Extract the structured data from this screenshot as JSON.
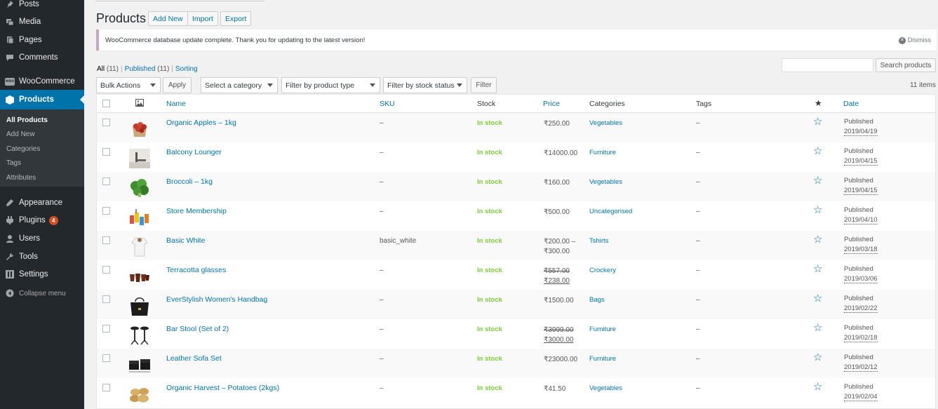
{
  "sidebar": {
    "items": [
      {
        "label": "Posts",
        "icon": "pushpin-icon"
      },
      {
        "label": "Media",
        "icon": "media-icon"
      },
      {
        "label": "Pages",
        "icon": "pages-icon"
      },
      {
        "label": "Comments",
        "icon": "comments-icon"
      },
      {
        "label": "WooCommerce",
        "icon": "woocommerce-icon"
      },
      {
        "label": "Products",
        "icon": "products-icon"
      },
      {
        "label": "Appearance",
        "icon": "appearance-icon"
      },
      {
        "label": "Plugins",
        "icon": "plugins-icon",
        "badge": "4"
      },
      {
        "label": "Users",
        "icon": "users-icon"
      },
      {
        "label": "Tools",
        "icon": "tools-icon"
      },
      {
        "label": "Settings",
        "icon": "settings-icon"
      },
      {
        "label": "Collapse menu",
        "icon": "collapse-icon"
      }
    ],
    "submenu": [
      "All Products",
      "Add New",
      "Categories",
      "Tags",
      "Attributes"
    ]
  },
  "header": {
    "title": "Products",
    "add_new": "Add New",
    "import": "Import",
    "export": "Export"
  },
  "notice": {
    "text": "WooCommerce database update complete. Thank you for updating to the latest version!",
    "dismiss": "Dismiss"
  },
  "views": {
    "all": "All",
    "all_count": "(11)",
    "published": "Published",
    "published_count": "(11)",
    "sorting": "Sorting",
    "separator": "|"
  },
  "search": {
    "placeholder": "",
    "button": "Search products"
  },
  "filters": {
    "bulk_actions": "Bulk Actions",
    "apply": "Apply",
    "category": "Select a category",
    "product_type": "Filter by product type",
    "stock_status": "Filter by stock status",
    "filter": "Filter",
    "items_count": "11 items"
  },
  "table": {
    "columns": {
      "name": "Name",
      "sku": "SKU",
      "stock": "Stock",
      "price": "Price",
      "categories": "Categories",
      "tags": "Tags",
      "date": "Date"
    },
    "rows": [
      {
        "name": "Organic Apples – 1kg",
        "sku": "–",
        "stock": "In stock",
        "price": "₹250.00",
        "price_sale": "",
        "category": "Vegetables",
        "tags": "–",
        "status": "Published",
        "date": "2019/04/19",
        "thumb": "apples"
      },
      {
        "name": "Balcony Lounger",
        "sku": "–",
        "stock": "In stock",
        "price": "₹14000.00",
        "price_sale": "",
        "category": "Furniture",
        "tags": "–",
        "status": "Published",
        "date": "2019/04/15",
        "thumb": "lounger"
      },
      {
        "name": "Broccoli – 1kg",
        "sku": "–",
        "stock": "In stock",
        "price": "₹160.00",
        "price_sale": "",
        "category": "Vegetables",
        "tags": "–",
        "status": "Published",
        "date": "2019/04/15",
        "thumb": "broccoli"
      },
      {
        "name": "Store Membership",
        "sku": "–",
        "stock": "In stock",
        "price": "₹500.00",
        "price_sale": "",
        "category": "Uncategorised",
        "tags": "–",
        "status": "Published",
        "date": "2019/04/10",
        "thumb": "membership"
      },
      {
        "name": "Basic White",
        "sku": "basic_white",
        "stock": "In stock",
        "price": "₹200.00 –",
        "price_sale": "₹300.00",
        "category": "Tshirts",
        "tags": "–",
        "status": "Published",
        "date": "2019/03/18",
        "thumb": "tshirt"
      },
      {
        "name": "Terracotta glasses",
        "sku": "–",
        "stock": "In stock",
        "price": "₹557.00",
        "price_sale": "₹238.00",
        "category": "Crockery",
        "tags": "–",
        "status": "Published",
        "date": "2019/03/06",
        "thumb": "glasses",
        "on_sale": true
      },
      {
        "name": "EverStylish Women's Handbag",
        "sku": "–",
        "stock": "In stock",
        "price": "₹1500.00",
        "price_sale": "",
        "category": "Bags",
        "tags": "–",
        "status": "Published",
        "date": "2019/02/22",
        "thumb": "handbag"
      },
      {
        "name": "Bar Stool (Set of 2)",
        "sku": "–",
        "stock": "In stock",
        "price": "₹3999.00",
        "price_sale": "₹3000.00",
        "category": "Furniture",
        "tags": "–",
        "status": "Published",
        "date": "2019/02/18",
        "thumb": "stool",
        "on_sale": true
      },
      {
        "name": "Leather Sofa Set",
        "sku": "–",
        "stock": "In stock",
        "price": "₹23000.00",
        "price_sale": "",
        "category": "Furniture",
        "tags": "–",
        "status": "Published",
        "date": "2019/02/12",
        "thumb": "sofa"
      },
      {
        "name": "Organic Harvest – Potatoes (2kgs)",
        "sku": "–",
        "stock": "In stock",
        "price": "₹41.50",
        "price_sale": "",
        "category": "Vegetables",
        "tags": "–",
        "status": "Published",
        "date": "2019/02/04",
        "thumb": "potatoes"
      }
    ]
  },
  "colors": {
    "sidebar_bg": "#23282d",
    "active": "#0073aa",
    "link": "#0073aa",
    "in_stock": "#7ad03a",
    "notice_border": "#c9a4c3"
  }
}
